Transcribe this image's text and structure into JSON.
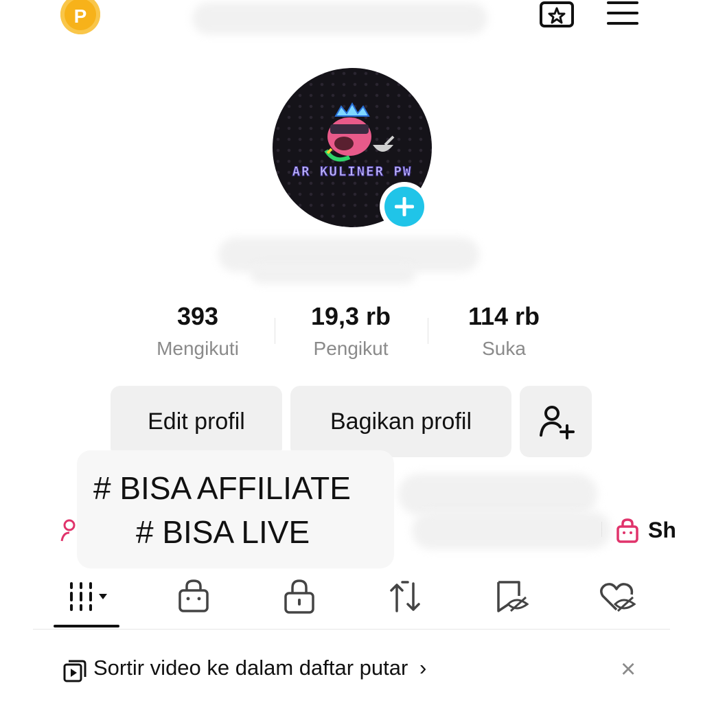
{
  "header": {
    "coin_badge": "P",
    "icons": [
      "coin-icon",
      "calendar-star-icon",
      "menu-icon"
    ]
  },
  "avatar": {
    "banner_text": "AR KULINER PW",
    "badge_icon": "plus-icon"
  },
  "stats": [
    {
      "value": "393",
      "label": "Mengikuti"
    },
    {
      "value": "19,3 rb",
      "label": "Pengikut"
    },
    {
      "value": "114 rb",
      "label": "Suka"
    }
  ],
  "actions": {
    "edit_label": "Edit profil",
    "share_label": "Bagikan profil",
    "add_friend_icon": "add-user-icon"
  },
  "bio": {
    "line1": "# BISA AFFILIATE",
    "line2": "# BISA LIVE"
  },
  "links": {
    "shop_partial": "Sh"
  },
  "tabs": [
    {
      "icon": "grid-icon",
      "selected": true
    },
    {
      "icon": "shopping-bag-icon"
    },
    {
      "icon": "lock-icon"
    },
    {
      "icon": "repost-icon"
    },
    {
      "icon": "hidden-bookmark-icon"
    },
    {
      "icon": "hidden-heart-icon"
    }
  ],
  "playlist_prompt": {
    "text": "Sortir video ke dalam daftar putar",
    "chevron": "›",
    "close": "×"
  },
  "colors": {
    "accent_cyan": "#20c4e8",
    "shop_pink": "#e0336b",
    "coin_gold": "#f7b21a"
  }
}
